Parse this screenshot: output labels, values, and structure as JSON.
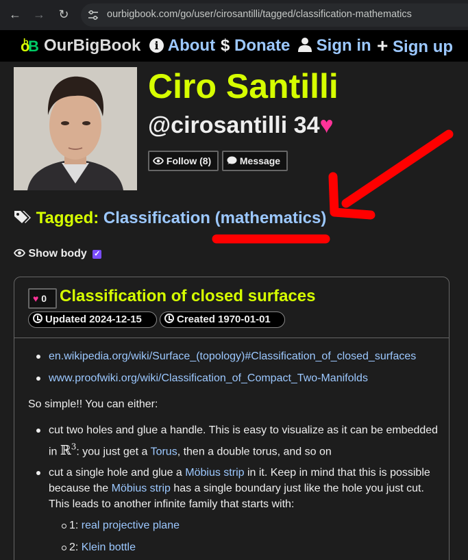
{
  "browser": {
    "url": "ourbigbook.com/go/user/cirosantilli/tagged/classification-mathematics"
  },
  "nav": {
    "logo_text": "OurBigBook",
    "about": "About",
    "donate": "Donate",
    "sign_in": "Sign in",
    "sign_up": "Sign up"
  },
  "profile": {
    "name": "Ciro Santilli",
    "handle": "@cirosantilli",
    "score": "34",
    "follow_label": "Follow (8)",
    "message_label": "Message"
  },
  "tagged": {
    "label": "Tagged:",
    "tag": "Classification (mathematics)"
  },
  "show_body": {
    "label": "Show body",
    "checked": true
  },
  "article": {
    "likes": "0",
    "title": "Classification of closed surfaces",
    "updated": "Updated 2024-12-15",
    "created": "Created 1970-01-01",
    "links": [
      "en.wikipedia.org/wiki/Surface_(topology)#Classification_of_closed_surfaces",
      "www.proofwiki.org/wiki/Classification_of_Compact_Two-Manifolds"
    ],
    "intro": "So simple!! You can either:",
    "item1_line1": "cut two holes and glue a handle. This is easy to visualize as it can be embedded",
    "item1_line2_pre": "in",
    "item1_math": "ℝ",
    "item1_math_sup": "3",
    "item1_line2_mid": ": you just get a",
    "item1_torus": "Torus",
    "item1_line2_post": ", then a double torus, and so on",
    "item2_line1_pre": "cut a single hole and glue a",
    "item2_mobius": "Möbius strip",
    "item2_line1_post": "in it. Keep in mind that this is possible",
    "item2_line2_pre": "because the",
    "item2_mobius2": "Möbius strip",
    "item2_line2_post": "has a single boundary just like the hole you just cut.",
    "item2_line3": "This leads to another infinite family that starts with:",
    "sub1_num": "1:",
    "sub1_link": "real projective plane",
    "sub2_num": "2:",
    "sub2_link": "Klein bottle"
  },
  "colors": {
    "title_accent": "#d6ff00",
    "link": "#9cc8ff",
    "heart": "#ff3399",
    "annotation": "#ff0000"
  }
}
